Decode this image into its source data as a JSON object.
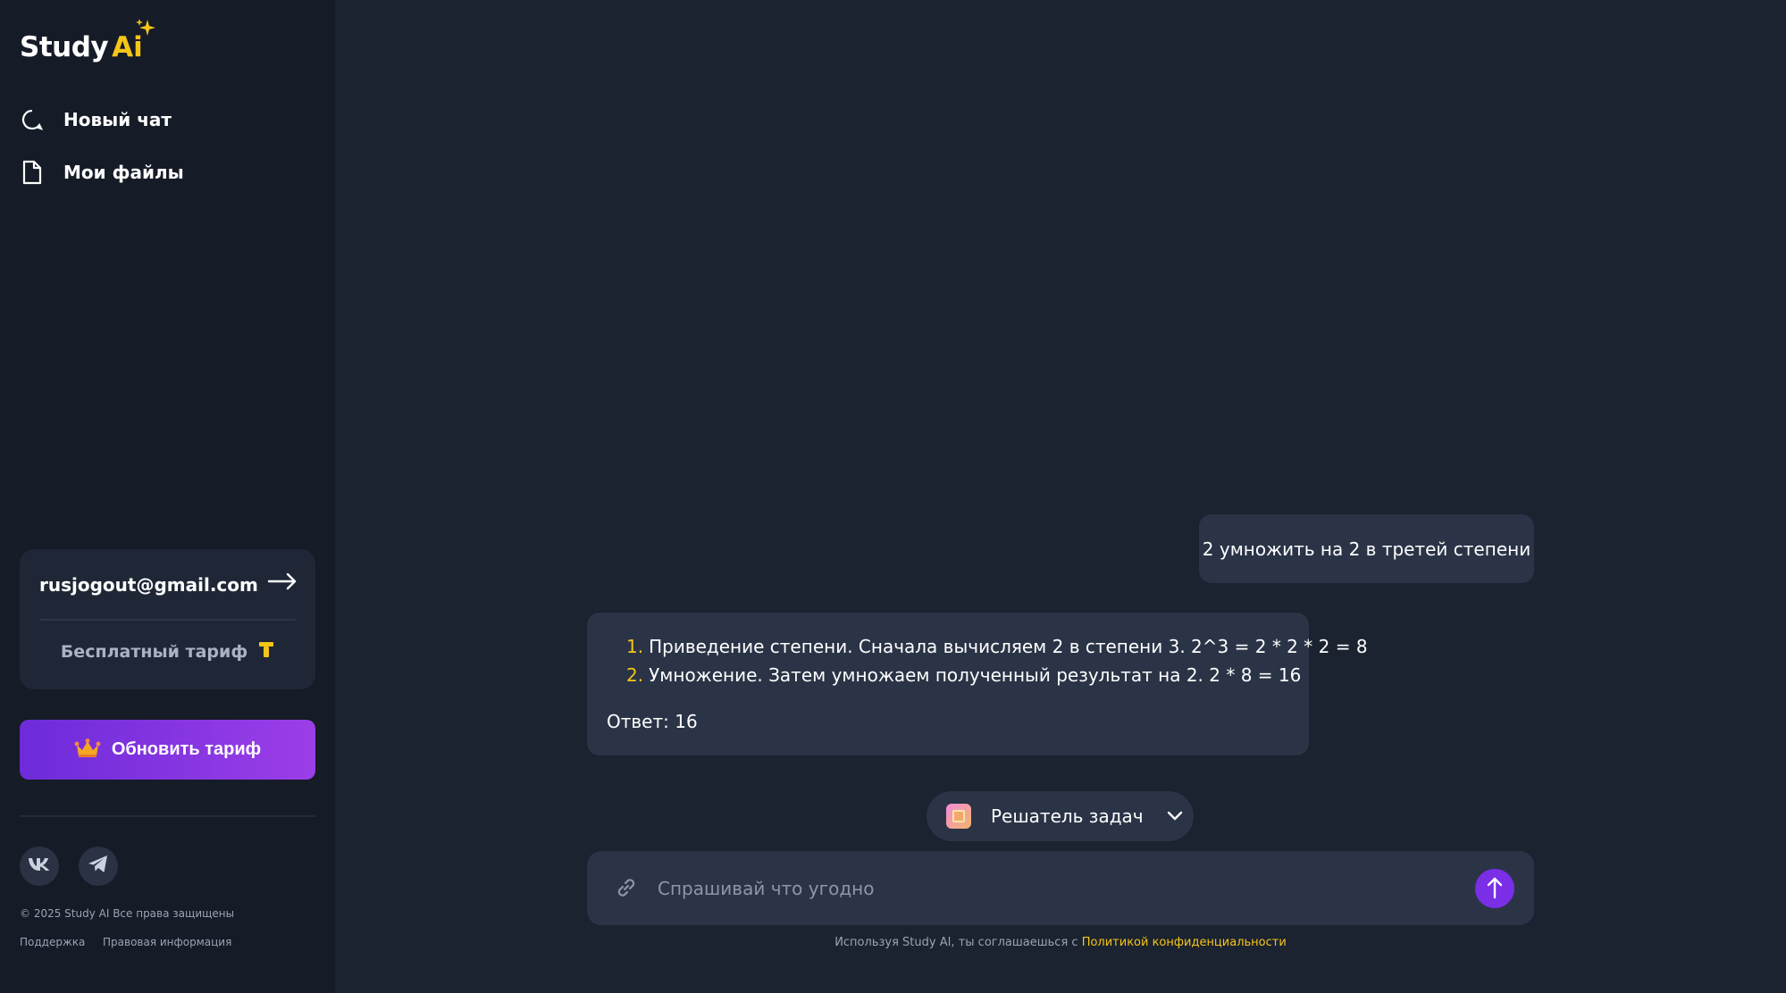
{
  "brand": {
    "name": "Study",
    "suffix": "Ai"
  },
  "sidebar": {
    "nav": [
      {
        "label": "Новый чат",
        "icon": "chat-icon"
      },
      {
        "label": "Мои файлы",
        "icon": "file-icon"
      }
    ],
    "account": {
      "email": "rusjogout@gmail.com",
      "plan": "Бесплатный тариф"
    },
    "upgrade_label": "Обновить тариф",
    "social": [
      "vk-icon",
      "telegram-icon"
    ],
    "copyright": "© 2025 Study AI Все права защищены",
    "links": {
      "support": "Поддержка",
      "legal": "Правовая информация"
    }
  },
  "chat": {
    "user_message": "2 умножить на 2 в третей степени",
    "ai_response": {
      "steps": [
        {
          "num": "1.",
          "text": "Приведение степени. Сначала вычисляем 2 в степени 3. 2^3 = 2 * 2 * 2 = 8"
        },
        {
          "num": "2.",
          "text": "Умножение. Затем умножаем полученный результат на 2. 2 * 8 = 16"
        }
      ],
      "answer": "Ответ: 16"
    }
  },
  "mode_selector": {
    "label": "Решатель задач"
  },
  "input": {
    "placeholder": "Спрашивай что угодно"
  },
  "disclaimer": {
    "text": "Используя Study AI, ты соглашаешься с ",
    "link": "Политикой конфиденциальности"
  },
  "colors": {
    "background": "#1b2230",
    "sidebar": "#151b27",
    "bubble": "#2a3446",
    "accent_yellow": "#f5c518",
    "accent_purple": "#7a2ee6"
  }
}
